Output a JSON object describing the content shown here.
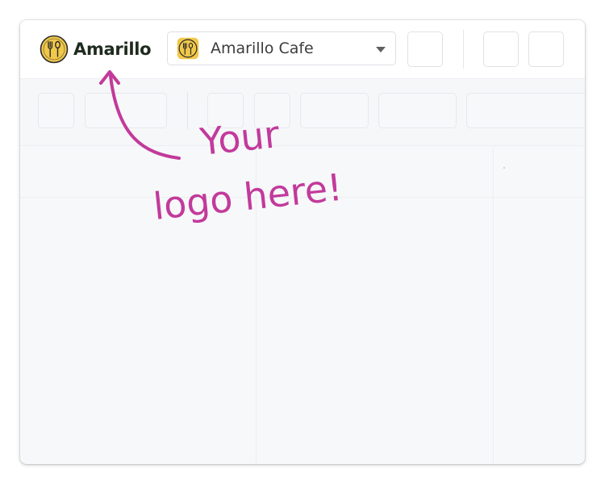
{
  "header": {
    "brand_name": "Amarillo",
    "brand_logo_icon": "fork-spoon-icon",
    "venue": {
      "selected": "Amarillo Cafe",
      "logo_icon": "fork-spoon-icon",
      "dropdown_icon": "chevron-down-icon"
    }
  },
  "annotation": {
    "line1": "Your",
    "line2": "logo here!",
    "color": "#c23a9b"
  },
  "colors": {
    "logo_yellow": "#f0c84a",
    "logo_dark": "#2a2a2a",
    "background": "#f7f8fa"
  }
}
